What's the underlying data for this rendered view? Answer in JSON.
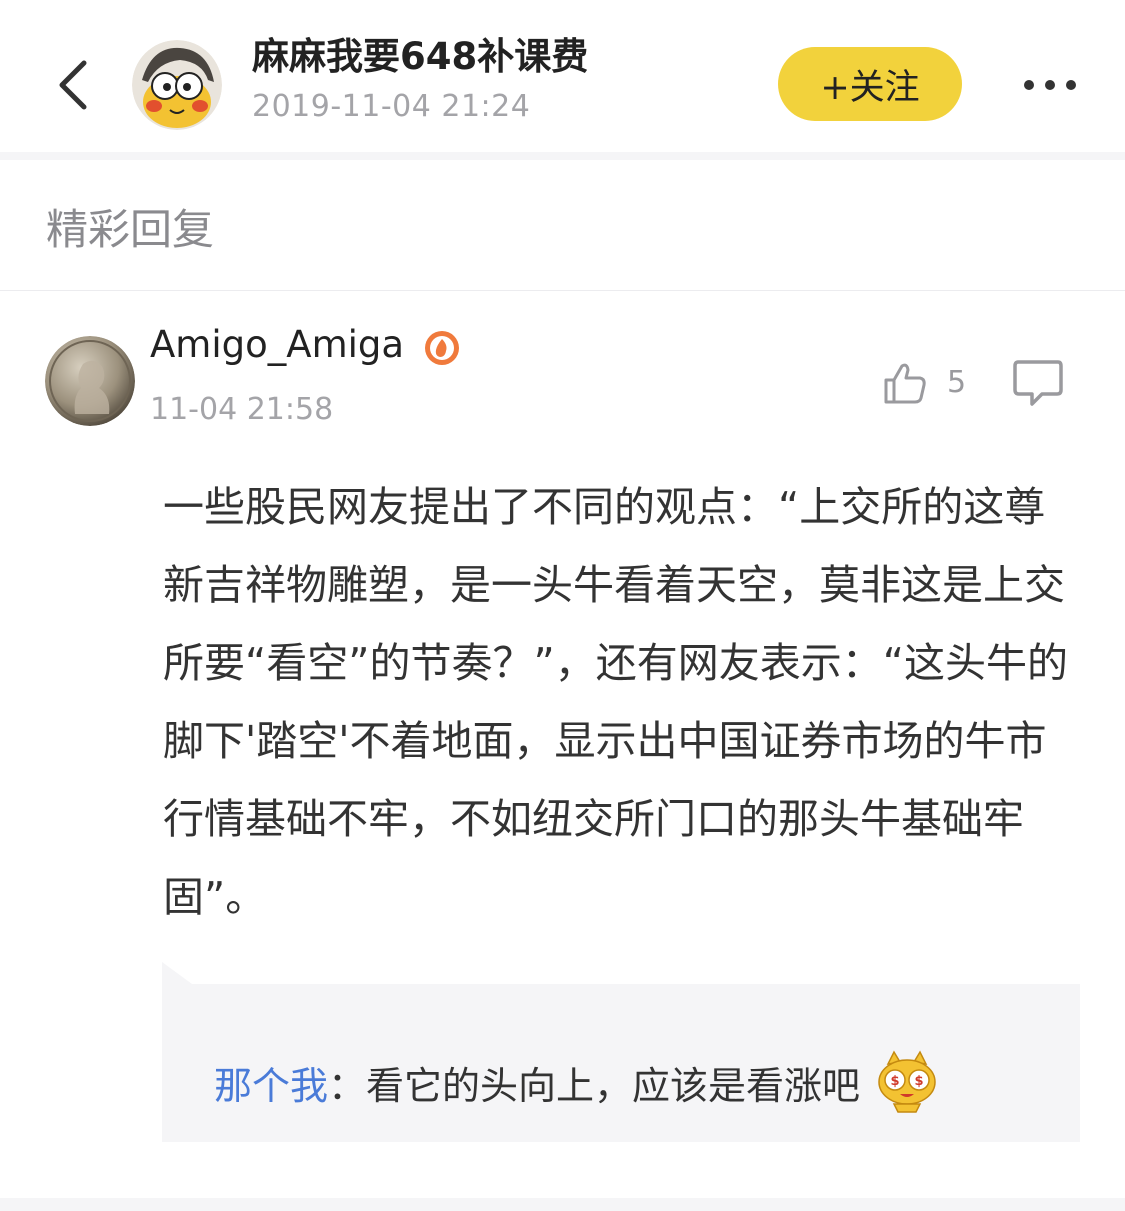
{
  "header": {
    "back_icon": "chevron-left-icon",
    "poster_name": "麻麻我要648补课费",
    "post_time": "2019-11-04 21:24",
    "follow_label": "+关注",
    "more_icon": "more-dots-icon",
    "follow_color": "#f2d23c"
  },
  "section": {
    "title": "精彩回复"
  },
  "comment": {
    "author": "Amigo_Amiga",
    "badge_icon": "hot-badge-icon",
    "time": "11-04 21:58",
    "like_icon": "thumbs-up-icon",
    "like_count": "5",
    "reply_icon": "comment-bubble-icon",
    "body": "一些股民网友提出了不同的观点：“上交所的这尊新吉祥物雕塑，是一头牛看着天空，莫非这是上交所要“看空”的节奏？”，还有网友表示：“这头牛的脚下'踏空'不着地面，显示出中国证券市场的牛市行情基础不牢，不如纽交所门口的那头牛基础牢固”。",
    "sub_reply": {
      "name": "那个我",
      "colon": "：",
      "text": "看它的头向上，应该是看涨吧",
      "emoji_icon": "money-eyes-tiger-emoji",
      "name_color": "#4a7bd8"
    }
  }
}
